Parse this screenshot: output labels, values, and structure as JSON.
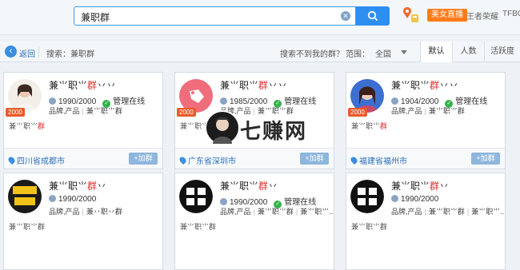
{
  "search": {
    "query": "兼职群"
  },
  "top_links": {
    "beauty_live": "美女直播",
    "game": "王者荣耀",
    "tfboys": "TFBO"
  },
  "filter": {
    "back": "返回",
    "search_prefix": "搜索：兼职群",
    "not_found": "搜索不到我的群？",
    "range_label": "范围：",
    "range_value": "全国",
    "sort_tabs": [
      "默认",
      "人数",
      "活跃度"
    ]
  },
  "join_label": "+加群",
  "level_badge": "2000",
  "cards": [
    {
      "name_a": "兼",
      "name_b": "⺌职",
      "name_c": "⺌",
      "name_d": "群",
      "name_e": "丷丷",
      "members": "1990/2000",
      "active": "管理在线",
      "tags": [
        "品牌,产品",
        "兼⺌职⺌群"
      ],
      "desc_a": "兼⺌职⺌",
      "desc_b": "群",
      "location": "四川省成都市",
      "avatar": "girl"
    },
    {
      "name_a": "兼",
      "name_b": "⺌职",
      "name_c": "⺌",
      "name_d": "群",
      "name_e": "丷丷",
      "members": "1985/2000",
      "active": "管理在线",
      "tags": [
        "品牌,产品",
        "兼⺌职⺌群"
      ],
      "desc_a": "兼⺌职⺌",
      "desc_b": "群",
      "location": "广东省深圳市",
      "avatar": "tag"
    },
    {
      "name_a": "兼",
      "name_b": "⺌职",
      "name_c": "⺌",
      "name_d": "群",
      "name_e": "丷丷",
      "members": "1904/2000",
      "active": "管理在线",
      "tags": [
        "品牌,产品",
        "兼⺌职⺌群"
      ],
      "desc_a": "兼⺌职⺌",
      "desc_b": "群",
      "location": "福建省福州市",
      "avatar": "woman"
    },
    {
      "name_a": "兼",
      "name_b": "⺌职",
      "name_c": "⺌",
      "name_d": "群",
      "name_e": "丷",
      "members": "1990/2000",
      "active": "",
      "tags": [
        "品牌,产品",
        "兼丷职丷群"
      ],
      "desc_a": "兼⺌职⺌群",
      "desc_b": "",
      "location": "",
      "avatar": "yellow"
    },
    {
      "name_a": "兼",
      "name_b": "⺌职",
      "name_c": "⺌",
      "name_d": "群",
      "name_e": "丷",
      "members": "1990/2000",
      "active": "管理在线",
      "tags": [
        "品牌,产品",
        "兼⺌职⺌群",
        "兼⺌职⺌..."
      ],
      "desc_a": "兼⺌职⺌群",
      "desc_b": "",
      "location": "",
      "avatar": "daini"
    },
    {
      "name_a": "兼",
      "name_b": "⺌职",
      "name_c": "⺌",
      "name_d": "群",
      "name_e": "丷",
      "members": "1990/2000",
      "active": "",
      "tags": [
        "品牌,产品",
        "兼⺌职⺌群",
        "兼⺌职⺌..."
      ],
      "desc_a": "兼⺌职⺌群",
      "desc_b": "",
      "location": "",
      "avatar": "daini"
    }
  ],
  "watermark": {
    "text": "七赚网"
  }
}
